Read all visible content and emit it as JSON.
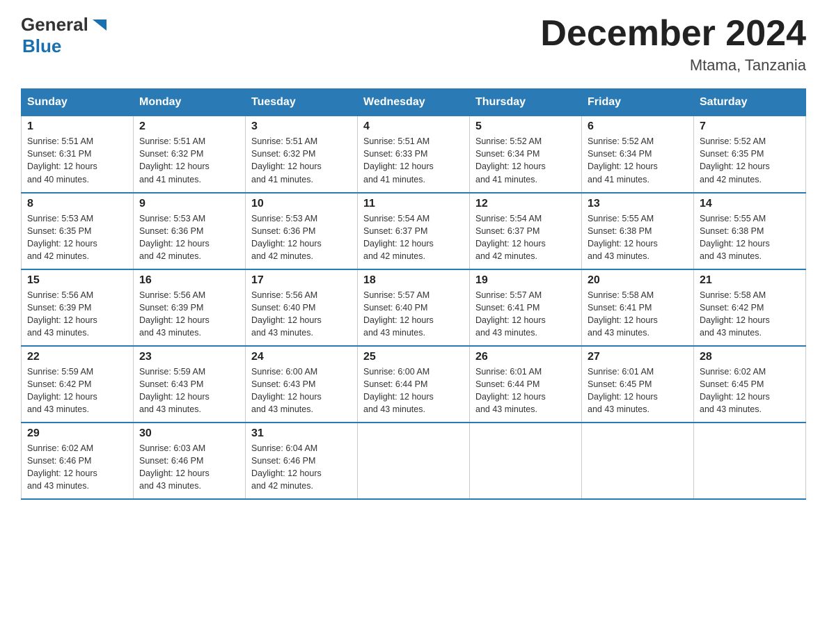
{
  "header": {
    "logo_general": "General",
    "logo_blue": "Blue",
    "month_title": "December 2024",
    "location": "Mtama, Tanzania"
  },
  "days_of_week": [
    "Sunday",
    "Monday",
    "Tuesday",
    "Wednesday",
    "Thursday",
    "Friday",
    "Saturday"
  ],
  "weeks": [
    [
      {
        "day": "1",
        "sunrise": "5:51 AM",
        "sunset": "6:31 PM",
        "daylight": "12 hours and 40 minutes."
      },
      {
        "day": "2",
        "sunrise": "5:51 AM",
        "sunset": "6:32 PM",
        "daylight": "12 hours and 41 minutes."
      },
      {
        "day": "3",
        "sunrise": "5:51 AM",
        "sunset": "6:32 PM",
        "daylight": "12 hours and 41 minutes."
      },
      {
        "day": "4",
        "sunrise": "5:51 AM",
        "sunset": "6:33 PM",
        "daylight": "12 hours and 41 minutes."
      },
      {
        "day": "5",
        "sunrise": "5:52 AM",
        "sunset": "6:34 PM",
        "daylight": "12 hours and 41 minutes."
      },
      {
        "day": "6",
        "sunrise": "5:52 AM",
        "sunset": "6:34 PM",
        "daylight": "12 hours and 41 minutes."
      },
      {
        "day": "7",
        "sunrise": "5:52 AM",
        "sunset": "6:35 PM",
        "daylight": "12 hours and 42 minutes."
      }
    ],
    [
      {
        "day": "8",
        "sunrise": "5:53 AM",
        "sunset": "6:35 PM",
        "daylight": "12 hours and 42 minutes."
      },
      {
        "day": "9",
        "sunrise": "5:53 AM",
        "sunset": "6:36 PM",
        "daylight": "12 hours and 42 minutes."
      },
      {
        "day": "10",
        "sunrise": "5:53 AM",
        "sunset": "6:36 PM",
        "daylight": "12 hours and 42 minutes."
      },
      {
        "day": "11",
        "sunrise": "5:54 AM",
        "sunset": "6:37 PM",
        "daylight": "12 hours and 42 minutes."
      },
      {
        "day": "12",
        "sunrise": "5:54 AM",
        "sunset": "6:37 PM",
        "daylight": "12 hours and 42 minutes."
      },
      {
        "day": "13",
        "sunrise": "5:55 AM",
        "sunset": "6:38 PM",
        "daylight": "12 hours and 43 minutes."
      },
      {
        "day": "14",
        "sunrise": "5:55 AM",
        "sunset": "6:38 PM",
        "daylight": "12 hours and 43 minutes."
      }
    ],
    [
      {
        "day": "15",
        "sunrise": "5:56 AM",
        "sunset": "6:39 PM",
        "daylight": "12 hours and 43 minutes."
      },
      {
        "day": "16",
        "sunrise": "5:56 AM",
        "sunset": "6:39 PM",
        "daylight": "12 hours and 43 minutes."
      },
      {
        "day": "17",
        "sunrise": "5:56 AM",
        "sunset": "6:40 PM",
        "daylight": "12 hours and 43 minutes."
      },
      {
        "day": "18",
        "sunrise": "5:57 AM",
        "sunset": "6:40 PM",
        "daylight": "12 hours and 43 minutes."
      },
      {
        "day": "19",
        "sunrise": "5:57 AM",
        "sunset": "6:41 PM",
        "daylight": "12 hours and 43 minutes."
      },
      {
        "day": "20",
        "sunrise": "5:58 AM",
        "sunset": "6:41 PM",
        "daylight": "12 hours and 43 minutes."
      },
      {
        "day": "21",
        "sunrise": "5:58 AM",
        "sunset": "6:42 PM",
        "daylight": "12 hours and 43 minutes."
      }
    ],
    [
      {
        "day": "22",
        "sunrise": "5:59 AM",
        "sunset": "6:42 PM",
        "daylight": "12 hours and 43 minutes."
      },
      {
        "day": "23",
        "sunrise": "5:59 AM",
        "sunset": "6:43 PM",
        "daylight": "12 hours and 43 minutes."
      },
      {
        "day": "24",
        "sunrise": "6:00 AM",
        "sunset": "6:43 PM",
        "daylight": "12 hours and 43 minutes."
      },
      {
        "day": "25",
        "sunrise": "6:00 AM",
        "sunset": "6:44 PM",
        "daylight": "12 hours and 43 minutes."
      },
      {
        "day": "26",
        "sunrise": "6:01 AM",
        "sunset": "6:44 PM",
        "daylight": "12 hours and 43 minutes."
      },
      {
        "day": "27",
        "sunrise": "6:01 AM",
        "sunset": "6:45 PM",
        "daylight": "12 hours and 43 minutes."
      },
      {
        "day": "28",
        "sunrise": "6:02 AM",
        "sunset": "6:45 PM",
        "daylight": "12 hours and 43 minutes."
      }
    ],
    [
      {
        "day": "29",
        "sunrise": "6:02 AM",
        "sunset": "6:46 PM",
        "daylight": "12 hours and 43 minutes."
      },
      {
        "day": "30",
        "sunrise": "6:03 AM",
        "sunset": "6:46 PM",
        "daylight": "12 hours and 43 minutes."
      },
      {
        "day": "31",
        "sunrise": "6:04 AM",
        "sunset": "6:46 PM",
        "daylight": "12 hours and 42 minutes."
      },
      null,
      null,
      null,
      null
    ]
  ],
  "labels": {
    "sunrise": "Sunrise:",
    "sunset": "Sunset:",
    "daylight": "Daylight:"
  }
}
